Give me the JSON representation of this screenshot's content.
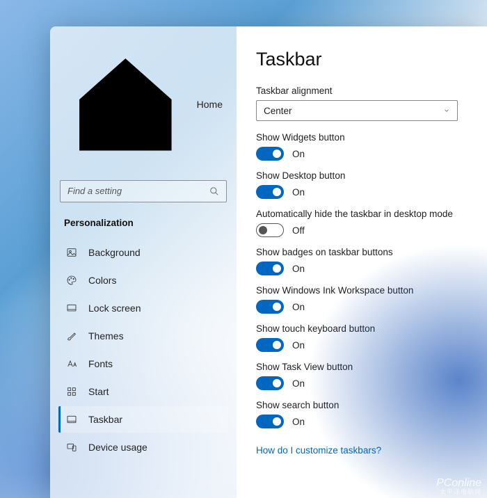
{
  "sidebar": {
    "home": "Home",
    "search_placeholder": "Find a setting",
    "section": "Personalization",
    "items": [
      {
        "key": "background",
        "label": "Background"
      },
      {
        "key": "colors",
        "label": "Colors"
      },
      {
        "key": "lock-screen",
        "label": "Lock screen"
      },
      {
        "key": "themes",
        "label": "Themes"
      },
      {
        "key": "fonts",
        "label": "Fonts"
      },
      {
        "key": "start",
        "label": "Start"
      },
      {
        "key": "taskbar",
        "label": "Taskbar",
        "active": true
      },
      {
        "key": "device-usage",
        "label": "Device usage"
      }
    ]
  },
  "page": {
    "title": "Taskbar",
    "alignment_label": "Taskbar alignment",
    "alignment_value": "Center",
    "settings": [
      {
        "key": "widgets",
        "label": "Show Widgets button",
        "on": true,
        "state": "On"
      },
      {
        "key": "desktop",
        "label": "Show Desktop button",
        "on": true,
        "state": "On"
      },
      {
        "key": "autohide",
        "label": "Automatically hide the taskbar in desktop mode",
        "on": false,
        "state": "Off"
      },
      {
        "key": "badges",
        "label": "Show badges on taskbar buttons",
        "on": true,
        "state": "On"
      },
      {
        "key": "ink",
        "label": "Show Windows Ink Workspace button",
        "on": true,
        "state": "On"
      },
      {
        "key": "touchkb",
        "label": "Show touch keyboard button",
        "on": true,
        "state": "On"
      },
      {
        "key": "taskview",
        "label": "Show Task View button",
        "on": true,
        "state": "On"
      },
      {
        "key": "search",
        "label": "Show search button",
        "on": true,
        "state": "On"
      }
    ],
    "help_link": "How do I customize taskbars?"
  },
  "watermark": {
    "main": "PConline",
    "sub": "太平洋电脑网"
  }
}
